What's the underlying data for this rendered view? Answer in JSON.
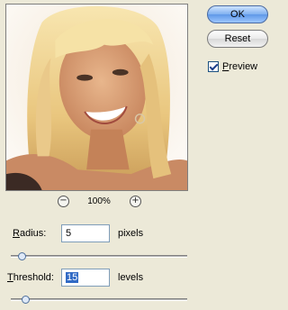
{
  "buttons": {
    "ok": "OK",
    "reset": "Reset"
  },
  "preview": {
    "label": "Preview",
    "checked": true
  },
  "zoom": {
    "value": "100%",
    "minus_symbol": "−",
    "plus_symbol": "+"
  },
  "radius": {
    "label_prefix": "R",
    "label_rest": "adius:",
    "value": "5",
    "unit": "pixels",
    "slider_fraction": 0.04
  },
  "threshold": {
    "label_prefix": "T",
    "label_rest": "hreshold:",
    "value": "15",
    "unit": "levels",
    "slider_fraction": 0.06
  }
}
